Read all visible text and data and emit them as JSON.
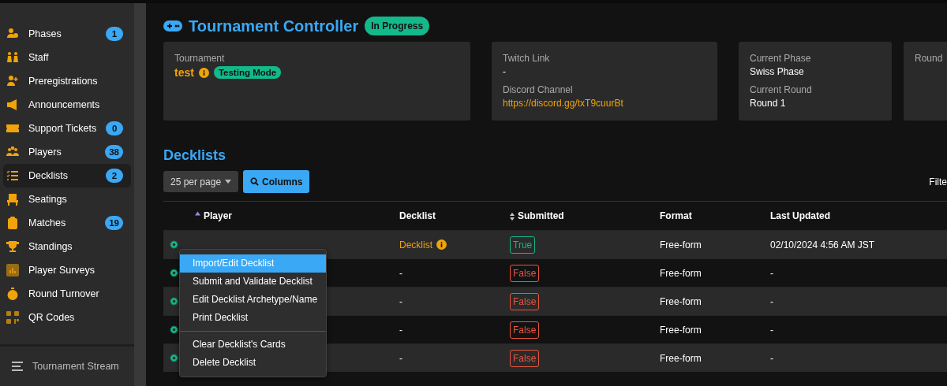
{
  "sidebar": {
    "items": [
      {
        "label": "Phases",
        "badge": "1",
        "selected": false
      },
      {
        "label": "Staff",
        "selected": false
      },
      {
        "label": "Preregistrations",
        "selected": false
      },
      {
        "label": "Announcements",
        "selected": false
      },
      {
        "label": "Support Tickets",
        "badge": "0",
        "selected": false
      },
      {
        "label": "Players",
        "badge": "38",
        "selected": false
      },
      {
        "label": "Decklists",
        "badge": "2",
        "selected": true
      },
      {
        "label": "Seatings",
        "selected": false
      },
      {
        "label": "Matches",
        "badge": "19",
        "selected": false
      },
      {
        "label": "Standings",
        "selected": false
      },
      {
        "label": "Player Surveys",
        "selected": false
      },
      {
        "label": "Round Turnover",
        "selected": false
      },
      {
        "label": "QR Codes",
        "selected": false
      }
    ],
    "footer": "Tournament Stream"
  },
  "header": {
    "title": "Tournament Controller",
    "status": "In Progress"
  },
  "cards": [
    {
      "fields": [
        {
          "label": "Tournament",
          "value": "test",
          "kind": "tournament",
          "badge": "Testing Mode"
        }
      ]
    },
    {
      "fields": [
        {
          "label": "Twitch Link",
          "value": "-",
          "kind": "text"
        },
        {
          "label": "Discord Channel",
          "value": "https://discord.gg/txT9cuurBt",
          "kind": "link"
        }
      ]
    },
    {
      "fields": [
        {
          "label": "Current Phase",
          "value": "Swiss Phase",
          "kind": "text"
        },
        {
          "label": "Current Round",
          "value": "Round 1",
          "kind": "text"
        }
      ]
    },
    {
      "fields": [
        {
          "label": "Round"
        }
      ]
    }
  ],
  "decklists": {
    "title": "Decklists",
    "per_page": "25 per page",
    "columns_button": "Columns",
    "filter_label": "Filte",
    "columns": [
      "Player",
      "Decklist",
      "Submitted",
      "Format",
      "Last Updated"
    ],
    "rows": [
      {
        "decklist": "Decklist",
        "decklist_link": true,
        "submitted": {
          "label": "True",
          "ok": true
        },
        "format": "Free-form",
        "last_updated": "02/10/2024 4:56 AM JST"
      },
      {
        "decklist": "-",
        "decklist_link": false,
        "submitted": {
          "label": "False",
          "ok": false
        },
        "format": "Free-form",
        "last_updated": "-"
      },
      {
        "decklist": "-",
        "decklist_link": false,
        "submitted": {
          "label": "False",
          "ok": false
        },
        "format": "Free-form",
        "last_updated": "-"
      },
      {
        "decklist": "-",
        "decklist_link": false,
        "submitted": {
          "label": "False",
          "ok": false
        },
        "format": "Free-form",
        "last_updated": "-"
      },
      {
        "decklist": "-",
        "decklist_link": false,
        "submitted": {
          "label": "False",
          "ok": false
        },
        "format": "Free-form",
        "last_updated": "-"
      }
    ],
    "menu": {
      "groups": [
        [
          {
            "label": "Import/Edit Decklist",
            "selected": true
          },
          {
            "label": "Submit and Validate Decklist",
            "selected": false
          },
          {
            "label": "Edit Decklist Archetype/Name",
            "selected": false
          },
          {
            "label": "Print Decklist",
            "selected": false
          }
        ],
        [
          {
            "label": "Clear Decklist's Cards",
            "selected": false
          },
          {
            "label": "Delete Decklist",
            "selected": false
          }
        ]
      ]
    }
  }
}
